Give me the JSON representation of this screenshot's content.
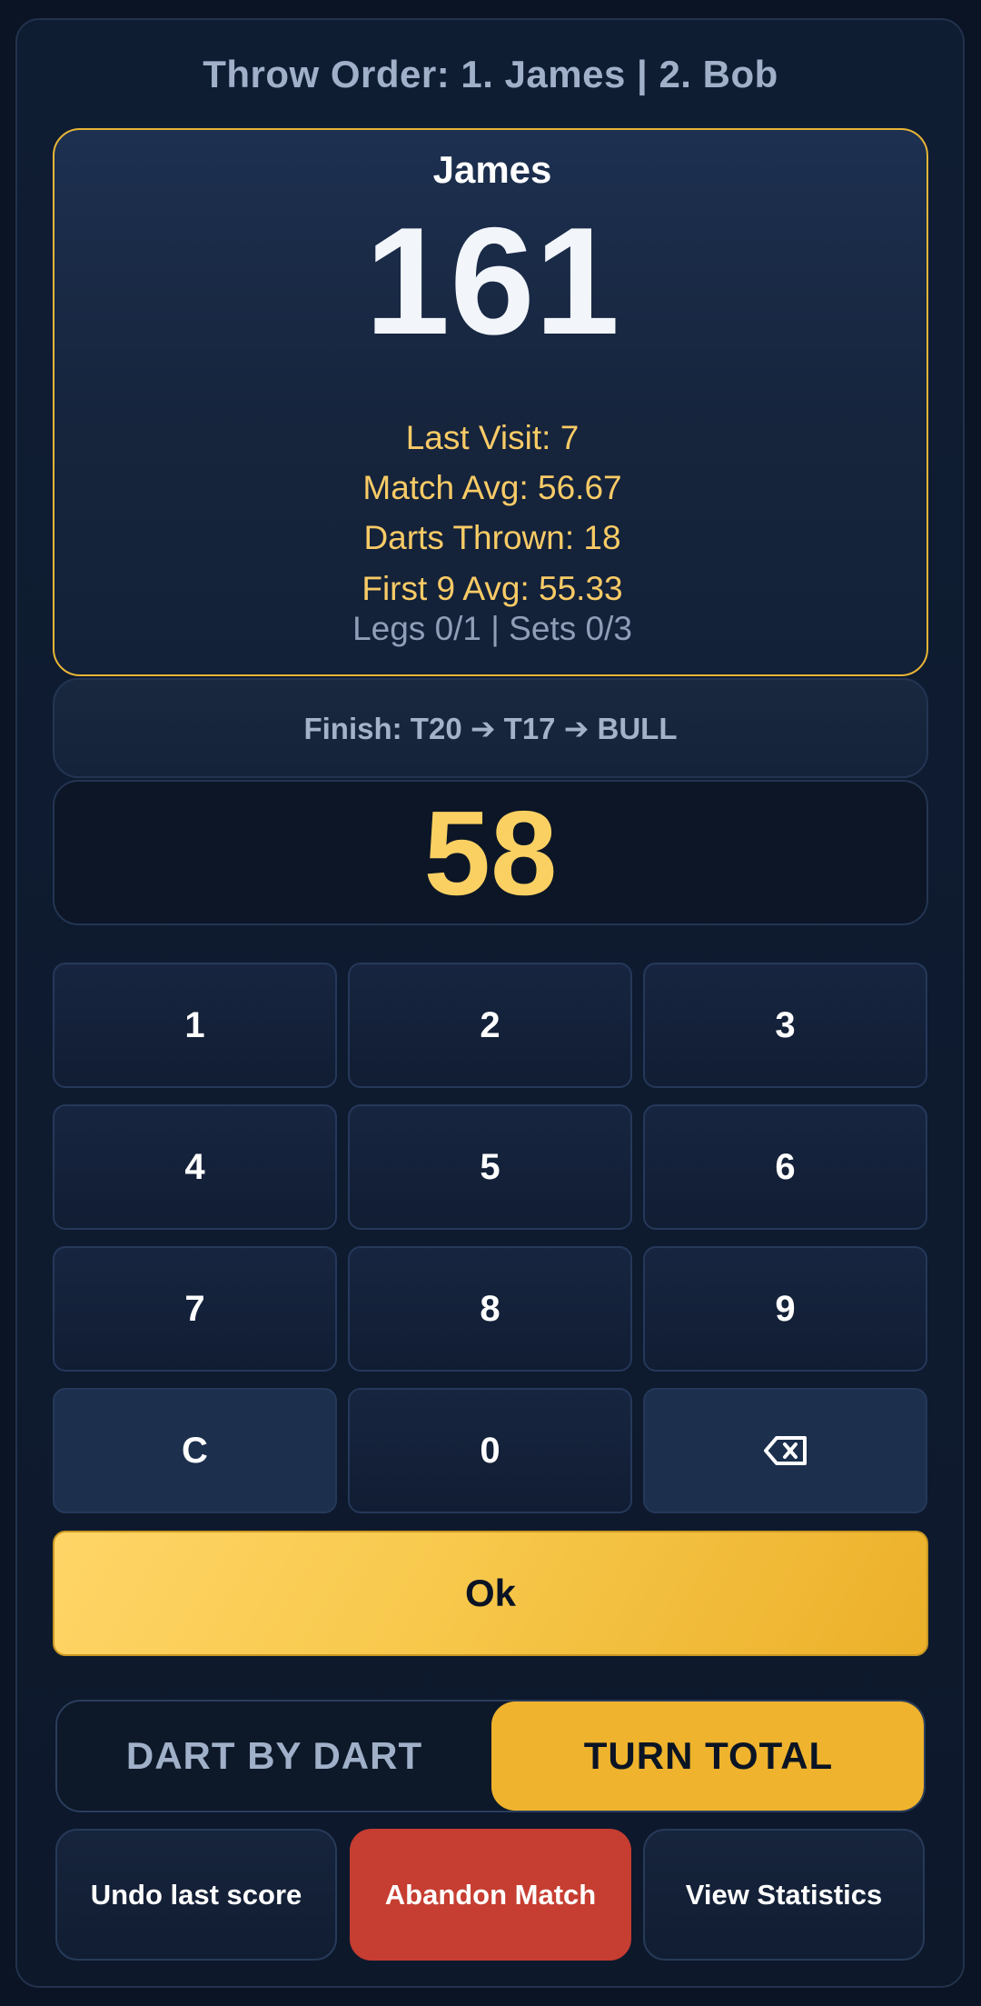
{
  "header": {
    "throw_order": "Throw Order: 1. James | 2. Bob"
  },
  "player": {
    "name": "James",
    "score": "161",
    "last_visit": "Last Visit: 7",
    "match_avg": "Match Avg: 56.67",
    "darts_thrown": "Darts Thrown: 18",
    "first9_avg": "First 9 Avg: 55.33",
    "legs_sets": "Legs 0/1 | Sets 0/3"
  },
  "finish": {
    "text": "Finish: T20 ➔ T17 ➔ BULL"
  },
  "entry": {
    "value": "58"
  },
  "keypad": {
    "k1": "1",
    "k2": "2",
    "k3": "3",
    "k4": "4",
    "k5": "5",
    "k6": "6",
    "k7": "7",
    "k8": "8",
    "k9": "9",
    "clear": "C",
    "k0": "0",
    "backspace_icon": "backspace-icon"
  },
  "ok": {
    "label": "Ok"
  },
  "mode": {
    "dart_by_dart": "DART BY DART",
    "turn_total": "TURN TOTAL",
    "active": "turn_total"
  },
  "actions": {
    "undo": "Undo last score",
    "abandon": "Abandon Match",
    "stats": "View Statistics"
  },
  "colors": {
    "accent": "#efb32d",
    "danger": "#c63d31",
    "stat_text": "#f9cb66",
    "background": "#0f1d33"
  }
}
